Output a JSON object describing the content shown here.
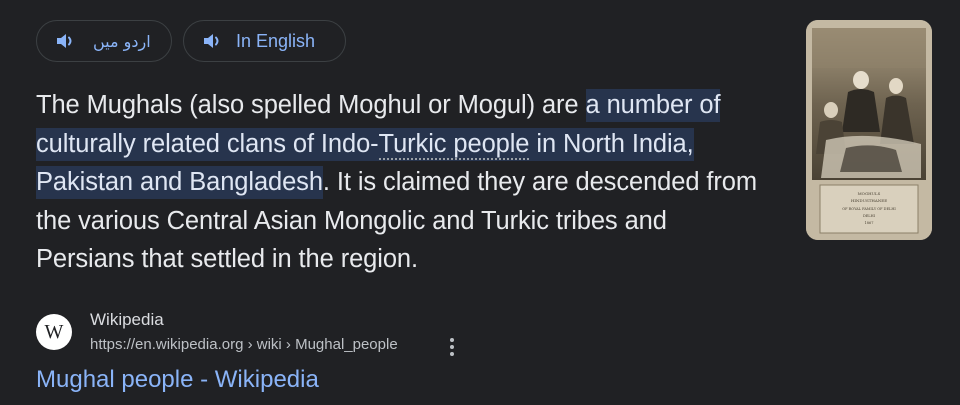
{
  "audio_buttons": [
    {
      "label": "اردو میں"
    },
    {
      "label": "In English"
    }
  ],
  "snippet": {
    "part1": "The Mughals (also spelled Moghul or Mogul) are ",
    "hl1": "a number of culturally related clans of Indo-",
    "hl_dotted": "Turkic people",
    "hl2": " in North India, Pakistan and Bangladesh",
    "part2": ". It is claimed they are descended from the various Central Asian Mongolic and Turkic tribes and Persians that settled in the region."
  },
  "thumbnail": {
    "caption_lines": [
      "MOGHULS",
      "HINDUSTHANEE",
      "OF ROYAL FAMILY OF DELHI",
      "DELHI",
      "1867"
    ]
  },
  "source": {
    "favicon_letter": "W",
    "site_name": "Wikipedia",
    "url": "https://en.wikipedia.org › wiki › Mughal_people",
    "title": "Mughal people - Wikipedia"
  },
  "icons": {
    "speaker": "speaker-icon",
    "more": "more-vert-icon"
  },
  "colors": {
    "background": "#202124",
    "link": "#8ab4f8",
    "highlight": "#27344d",
    "text": "#e8eaed"
  }
}
